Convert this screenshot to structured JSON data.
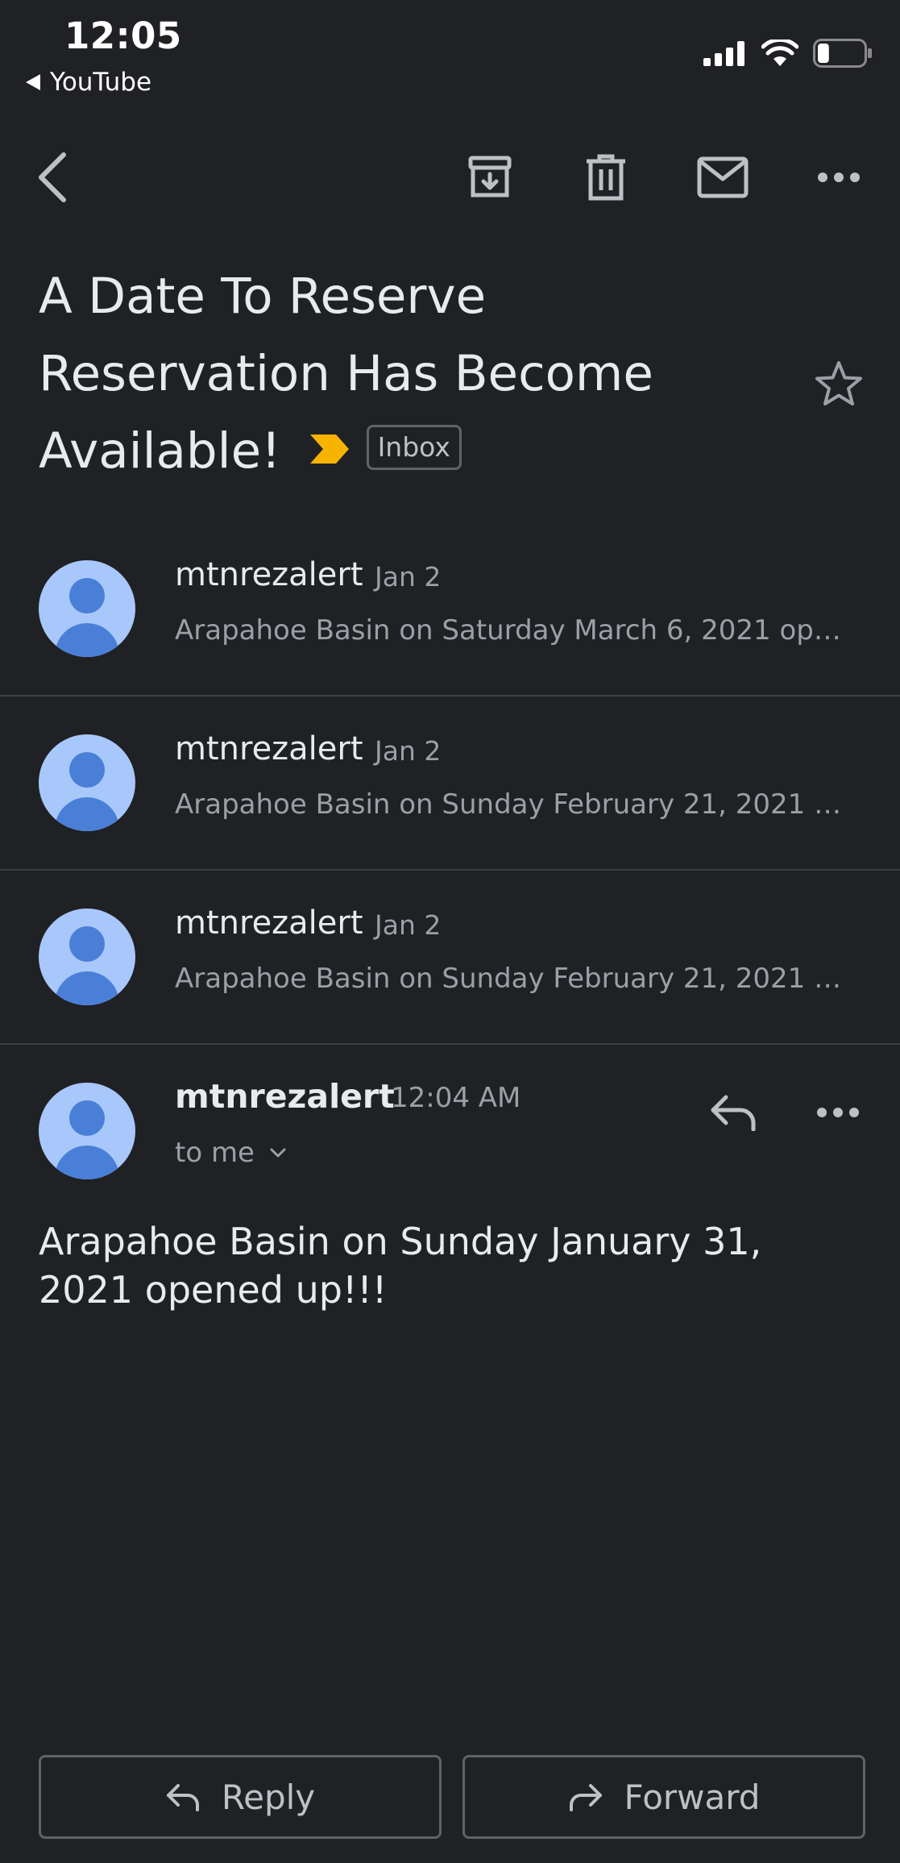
{
  "status_bar": {
    "time": "12:05",
    "back_app": "YouTube",
    "battery_level": 0.25
  },
  "toolbar": {
    "icons": [
      "chevron-left-icon",
      "archive-icon",
      "trash-icon",
      "mail-icon",
      "more-horiz-icon"
    ]
  },
  "subject": {
    "title": "A Date To Reserve Reservation Has Become Available!",
    "label": "Inbox",
    "important_color": "#f6b300"
  },
  "threads": [
    {
      "sender": "mtnrezalert",
      "date": "Jan 2",
      "snippet": "Arapahoe Basin on Saturday March 6, 2021 ope..."
    },
    {
      "sender": "mtnrezalert",
      "date": "Jan 2",
      "snippet": "Arapahoe Basin on Sunday February 21, 2021 o..."
    },
    {
      "sender": "mtnrezalert",
      "date": "Jan 2",
      "snippet": "Arapahoe Basin on Sunday February 21, 2021 o..."
    }
  ],
  "message": {
    "sender": "mtnrezalert",
    "time": "12:04 AM",
    "recipient": "to me",
    "body": "Arapahoe Basin on Sunday January 31, 2021 opened up!!!"
  },
  "actions": {
    "reply_label": "Reply",
    "forward_label": "Forward"
  },
  "colors": {
    "background": "#202124",
    "avatar_bg": "#a8c7fa",
    "avatar_fg": "#4a7fd8"
  }
}
